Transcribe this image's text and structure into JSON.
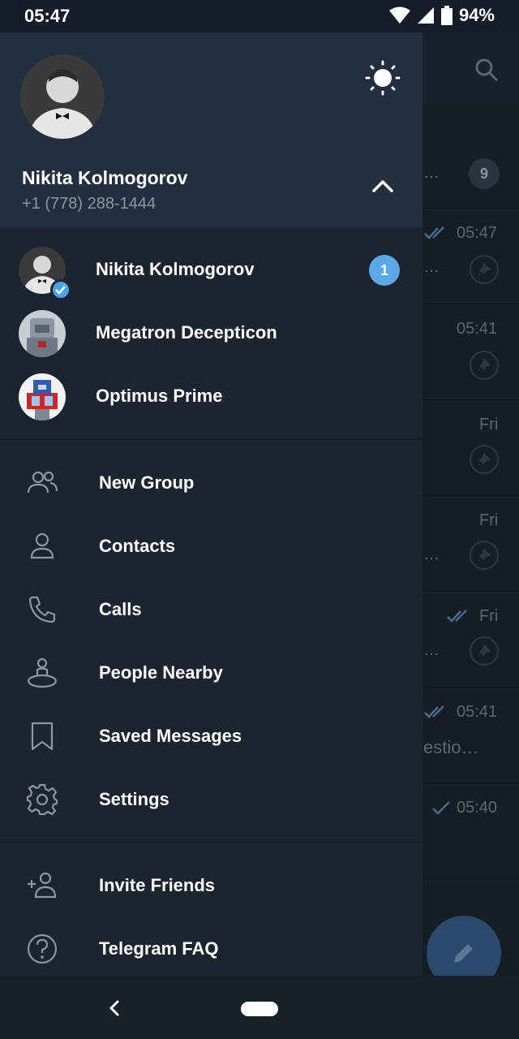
{
  "status_bar": {
    "time": "05:47",
    "battery": "94%"
  },
  "background_list": {
    "badge_count": "9",
    "rows": [
      {
        "time": "05:47",
        "snippet": "…"
      },
      {
        "time": "05:41",
        "snippet": ""
      },
      {
        "time": "Fri",
        "snippet": ""
      },
      {
        "time": "Fri",
        "snippet": "…"
      },
      {
        "time": "Fri",
        "snippet": "…"
      },
      {
        "time": "05:41",
        "snippet": "estio…"
      },
      {
        "time": "05:40",
        "snippet": ""
      }
    ]
  },
  "drawer": {
    "header": {
      "name": "Nikita Kolmogorov",
      "phone": "+1 (778) 288-1444"
    },
    "accounts": [
      {
        "name": "Nikita Kolmogorov",
        "badge": "1"
      },
      {
        "name": "Megatron Decepticon"
      },
      {
        "name": "Optimus Prime"
      }
    ],
    "menu": {
      "new_group": "New Group",
      "contacts": "Contacts",
      "calls": "Calls",
      "people_nearby": "People Nearby",
      "saved_messages": "Saved Messages",
      "settings": "Settings",
      "invite_friends": "Invite Friends",
      "telegram_faq": "Telegram FAQ"
    }
  },
  "colors": {
    "drawer_bg": "#1c242f",
    "header_bg": "#232f3e",
    "accent": "#5aa8e6"
  }
}
